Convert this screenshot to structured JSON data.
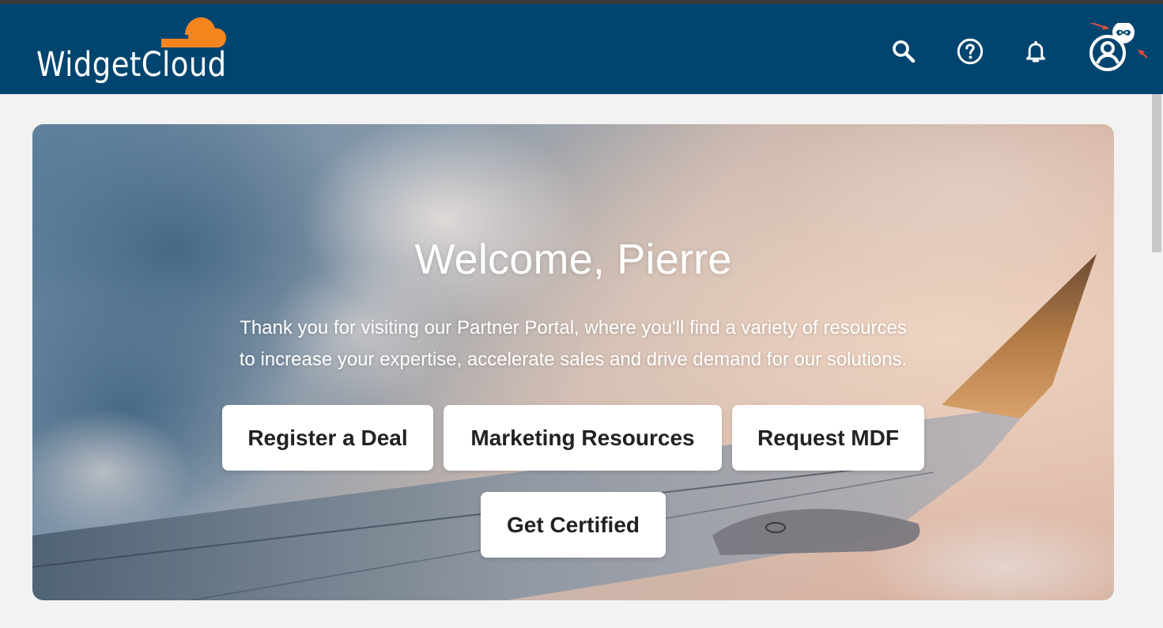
{
  "brand": {
    "name": "WidgetCloud",
    "accent_color": "#f6851f",
    "header_color": "#00456f"
  },
  "header": {
    "icons": [
      "search-icon",
      "help-icon",
      "bell-icon",
      "user-account-icon"
    ]
  },
  "hero": {
    "title": "Welcome, Pierre",
    "subtitle_line1": "Thank you for visiting our Partner Portal, where you'll find a variety of resources",
    "subtitle_line2": "to increase your expertise, accelerate sales and drive demand for our solutions.",
    "buttons": [
      {
        "label": "Register a Deal"
      },
      {
        "label": "Marketing Resources"
      },
      {
        "label": "Request MDF"
      },
      {
        "label": "Get Certified"
      }
    ]
  }
}
